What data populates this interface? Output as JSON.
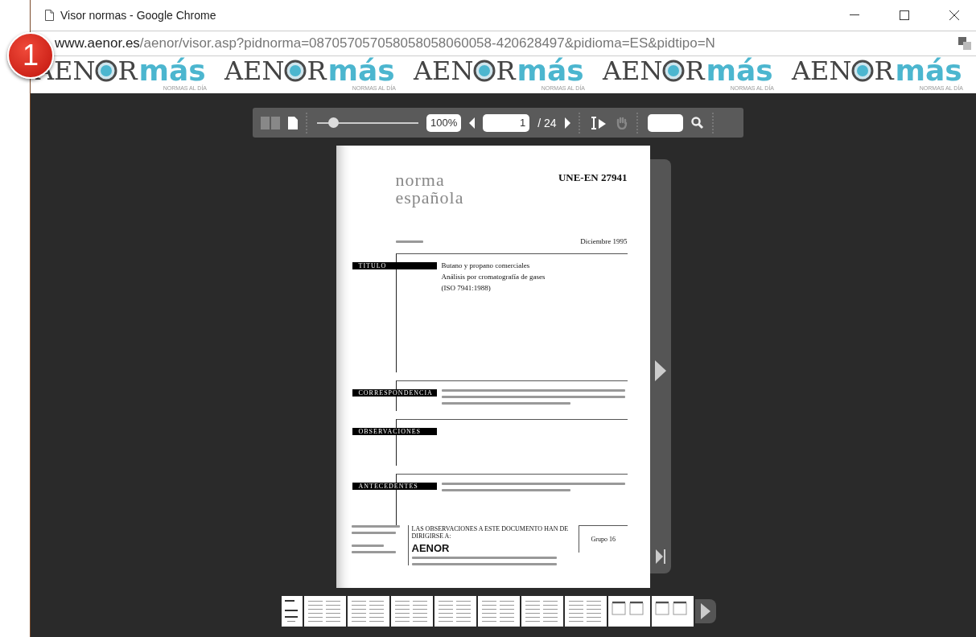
{
  "window": {
    "title": "Visor normas - Google Chrome"
  },
  "address_bar": {
    "host": "www.aenor.es",
    "path": "/aenor/visor.asp?pidnorma=087057057058058058060058-420628497&pidioma=ES&pidtipo=N"
  },
  "step_badge": "1",
  "banner": {
    "logos": [
      {
        "left": "AEN",
        "right": "R",
        "accent": "más",
        "tagline": "NORMAS AL DÍA"
      },
      {
        "left": "AEN",
        "right": "R",
        "accent": "más",
        "tagline": "NORMAS AL DÍA"
      },
      {
        "left": "AEN",
        "right": "R",
        "accent": "más",
        "tagline": "NORMAS AL DÍA"
      },
      {
        "left": "AEN",
        "right": "R",
        "accent": "más",
        "tagline": "NORMAS AL DÍA"
      },
      {
        "left": "AEN",
        "right": "R",
        "accent": "más",
        "tagline": "NORMAS AL DÍA"
      }
    ]
  },
  "toolbar": {
    "views": [
      {
        "kind": "double",
        "selected": false
      },
      {
        "kind": "single",
        "selected": true
      }
    ],
    "zoom": {
      "level": 0.16,
      "value": "100%"
    },
    "page": {
      "value": "1",
      "total": "/ 24"
    },
    "tools": [
      {
        "kind": "text-select",
        "selected": true
      },
      {
        "kind": "pan",
        "selected": false
      }
    ]
  },
  "document": {
    "heading": [
      "norma",
      "española"
    ],
    "code": "UNE-EN 27941",
    "date": "Diciembre 1995",
    "sections": [
      {
        "label": "TITULO",
        "lines": [
          "Butano y propano comerciales",
          "Análisis por cromatografía de gases",
          "(ISO 7941:1988)"
        ]
      },
      {
        "label": "CORRESPONDENCIA"
      },
      {
        "label": "OBSERVACIONES"
      },
      {
        "label": "ANTECEDENTES"
      }
    ],
    "footer": {
      "notice": "LAS OBSERVACIONES A ESTE DOCUMENTO HAN DE DIRIGIRSE A:",
      "org": "AENOR",
      "group": "Grupo 16"
    }
  },
  "thumbnails": [
    {
      "kind": "cover"
    },
    {
      "kind": "text"
    },
    {
      "kind": "text"
    },
    {
      "kind": "text"
    },
    {
      "kind": "text"
    },
    {
      "kind": "text"
    },
    {
      "kind": "text"
    },
    {
      "kind": "text"
    },
    {
      "kind": "table"
    },
    {
      "kind": "table"
    }
  ]
}
